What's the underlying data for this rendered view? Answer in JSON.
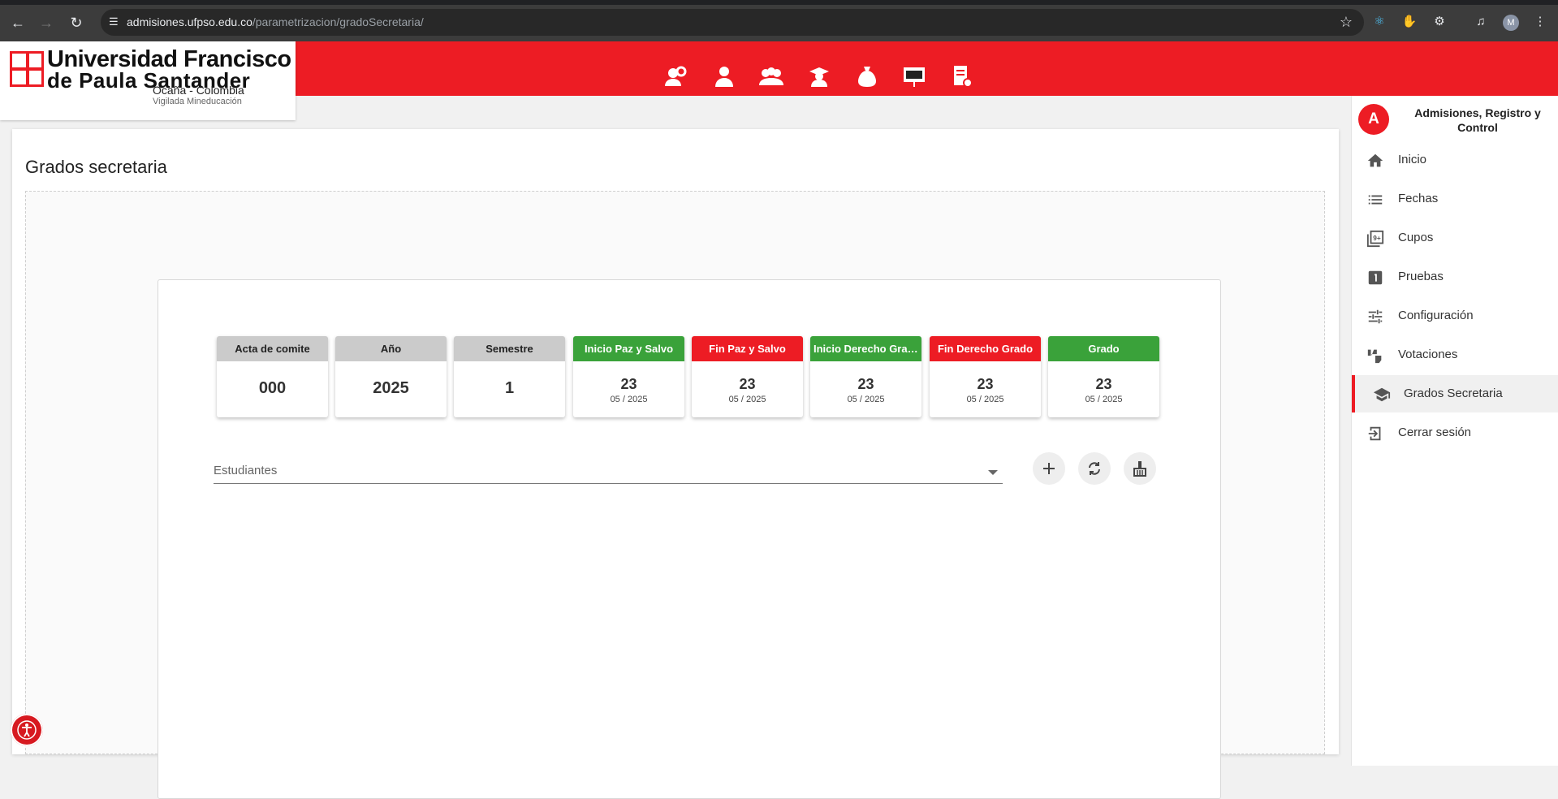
{
  "browser": {
    "url_host": "admisiones.ufpso.edu.co",
    "url_path": "/parametrizacion/gradoSecretaria/",
    "profile_initial": "M"
  },
  "header": {
    "logo_line1": "Universidad Francisco",
    "logo_line2": "de Paula Santander",
    "logo_line3": "Ocaña - Colombia",
    "logo_line4": "Vigilada Mineducación",
    "accent_color": "#ed1c24",
    "nav_icons": [
      "settings-person-icon",
      "person-icon",
      "group-icon",
      "student-icon",
      "money-bag-icon",
      "presentation-icon",
      "document-settings-icon"
    ]
  },
  "page": {
    "title": "Grados secretaria"
  },
  "cards": [
    {
      "label": "Acta de comite",
      "value": "000",
      "sub": "",
      "color": "grey"
    },
    {
      "label": "Año",
      "value": "2025",
      "sub": "",
      "color": "grey"
    },
    {
      "label": "Semestre",
      "value": "1",
      "sub": "",
      "color": "grey"
    },
    {
      "label": "Inicio Paz y Salvo",
      "value": "23",
      "sub": "05 / 2025",
      "color": "green"
    },
    {
      "label": "Fin Paz y Salvo",
      "value": "23",
      "sub": "05 / 2025",
      "color": "red"
    },
    {
      "label": "Inicio Derecho Grado",
      "value": "23",
      "sub": "05 / 2025",
      "color": "green"
    },
    {
      "label": "Fin Derecho Grado",
      "value": "23",
      "sub": "05 / 2025",
      "color": "red"
    },
    {
      "label": "Grado",
      "value": "23",
      "sub": "05 / 2025",
      "color": "green"
    }
  ],
  "students_select": {
    "label": "Estudiantes"
  },
  "sidebar": {
    "avatar_letter": "A",
    "title": "Admisiones, Registro y Control",
    "items": [
      {
        "label": "Inicio",
        "icon": "home-icon"
      },
      {
        "label": "Fechas",
        "icon": "list-icon"
      },
      {
        "label": "Cupos",
        "icon": "filter-9plus-icon"
      },
      {
        "label": "Pruebas",
        "icon": "looks-one-icon"
      },
      {
        "label": "Configuración",
        "icon": "tune-icon"
      },
      {
        "label": "Votaciones",
        "icon": "thumbs-icon"
      },
      {
        "label": "Grados Secretaria",
        "icon": "school-icon",
        "active": true
      },
      {
        "label": "Cerrar sesión",
        "icon": "logout-icon"
      }
    ]
  }
}
